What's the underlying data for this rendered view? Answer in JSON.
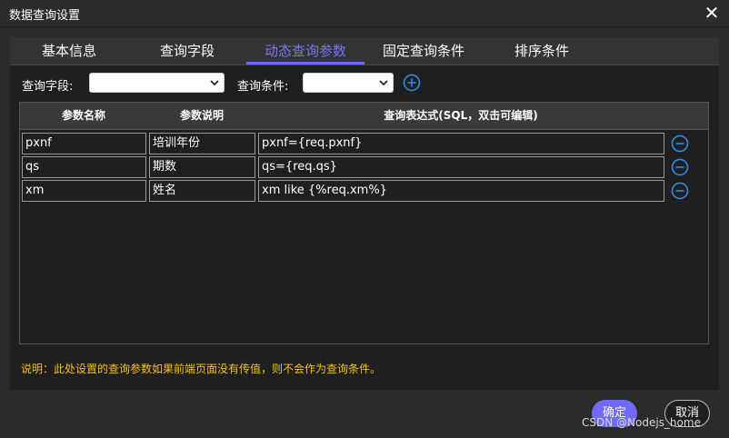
{
  "window": {
    "title": "数据查询设置"
  },
  "tabs": [
    {
      "label": "基本信息"
    },
    {
      "label": "查询字段"
    },
    {
      "label": "动态查询参数",
      "active": true
    },
    {
      "label": "固定查询条件"
    },
    {
      "label": "排序条件"
    }
  ],
  "filters": {
    "field_label": "查询字段:",
    "field_value": "",
    "condition_label": "查询条件:",
    "condition_value": ""
  },
  "table": {
    "columns": [
      "参数名称",
      "参数说明",
      "查询表达式(SQL，双击可编辑)"
    ],
    "rows": [
      {
        "name": "pxnf",
        "desc": "培训年份",
        "expr": "pxnf={req.pxnf}"
      },
      {
        "name": "qs",
        "desc": "期数",
        "expr": "qs={req.qs}"
      },
      {
        "name": "xm",
        "desc": "姓名",
        "expr": "xm like {%req.xm%}"
      }
    ]
  },
  "note": "说明：此处设置的查询参数如果前端页面没有传值，则不会作为查询条件。",
  "buttons": {
    "ok": "确定",
    "cancel": "取消"
  },
  "watermark": "CSDN @Nodejs_home",
  "colors": {
    "accent": "#6f6af8",
    "icon_blue": "#2f8ff7",
    "note": "#f0c21b",
    "background": "#1f1f1f"
  },
  "icons": {
    "close": "close-icon",
    "add": "plus-circle-icon",
    "remove": "minus-circle-icon"
  }
}
